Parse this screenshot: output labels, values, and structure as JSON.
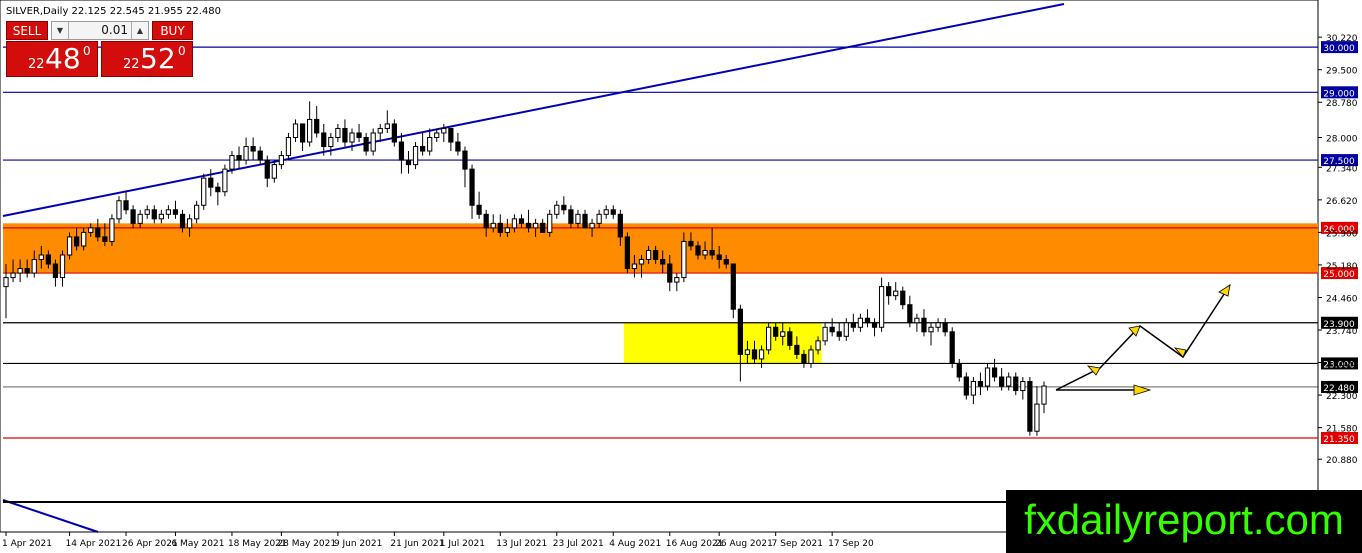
{
  "header": {
    "symbol_line": "SILVER,Daily  22.125 22.545 21.955 22.480"
  },
  "trade_panel": {
    "sell_label": "SELL",
    "buy_label": "BUY",
    "lot": "0.01",
    "sell_big": "22",
    "sell_main": "48",
    "sell_sup": "0",
    "buy_big": "22",
    "buy_main": "52",
    "buy_sup": "0"
  },
  "brand": {
    "text": "fxdailyreport.com",
    "text_color": "#33ff00",
    "bg_color": "#000000"
  },
  "chart_data": {
    "type": "candlestick",
    "symbol": "SILVER",
    "timeframe": "Daily",
    "ylim": [
      20.5,
      30.8
    ],
    "y_ticks": [
      "30.220",
      "29.500",
      "28.780",
      "28.000",
      "27.340",
      "26.620",
      "25.900",
      "25.180",
      "24.460",
      "23.740",
      "23.020",
      "22.300",
      "21.580",
      "20.880"
    ],
    "x_labels": [
      "1 Apr 2021",
      "14 Apr 2021",
      "26 Apr 2021",
      "6 May 2021",
      "18 May 2021",
      "28 May 2021",
      "9 Jun 2021",
      "21 Jun 2021",
      "1 Jul 2021",
      "13 Jul 2021",
      "23 Jul 2021",
      "4 Aug 2021",
      "16 Aug 2021",
      "26 Aug 2021",
      "7 Sep 2021",
      "17 Sep 20"
    ],
    "x_label_index": [
      0,
      9,
      17,
      24,
      32,
      39,
      47,
      55,
      62,
      70,
      78,
      86,
      94,
      101,
      109,
      117
    ],
    "n_bars": 126,
    "candles_ohlc": [
      [
        24.7,
        25.2,
        24.0,
        24.9
      ],
      [
        24.9,
        25.3,
        24.8,
        25.0
      ],
      [
        25.0,
        25.3,
        24.8,
        25.1
      ],
      [
        25.1,
        25.3,
        24.9,
        25.0
      ],
      [
        25.0,
        25.5,
        24.9,
        25.3
      ],
      [
        25.3,
        25.6,
        25.1,
        25.4
      ],
      [
        25.4,
        25.5,
        25.1,
        25.2
      ],
      [
        25.2,
        25.3,
        24.7,
        24.9
      ],
      [
        24.9,
        25.5,
        24.7,
        25.4
      ],
      [
        25.4,
        25.9,
        25.3,
        25.8
      ],
      [
        25.8,
        26.0,
        25.5,
        25.6
      ],
      [
        25.6,
        26.0,
        25.5,
        25.9
      ],
      [
        25.9,
        26.1,
        25.8,
        26.0
      ],
      [
        26.0,
        26.2,
        25.7,
        25.8
      ],
      [
        25.8,
        26.1,
        25.6,
        25.7
      ],
      [
        25.7,
        26.3,
        25.6,
        26.2
      ],
      [
        26.2,
        26.7,
        26.1,
        26.6
      ],
      [
        26.6,
        26.8,
        26.3,
        26.4
      ],
      [
        26.4,
        26.5,
        26.0,
        26.1
      ],
      [
        26.1,
        26.4,
        26.0,
        26.3
      ],
      [
        26.3,
        26.5,
        26.2,
        26.4
      ],
      [
        26.4,
        26.5,
        26.1,
        26.2
      ],
      [
        26.2,
        26.4,
        26.1,
        26.3
      ],
      [
        26.3,
        26.5,
        26.2,
        26.4
      ],
      [
        26.4,
        26.6,
        26.2,
        26.3
      ],
      [
        26.3,
        26.4,
        25.9,
        26.0
      ],
      [
        26.0,
        26.3,
        25.8,
        26.2
      ],
      [
        26.2,
        26.6,
        26.1,
        26.5
      ],
      [
        26.5,
        27.2,
        26.4,
        27.1
      ],
      [
        27.1,
        27.3,
        26.7,
        26.9
      ],
      [
        26.9,
        27.0,
        26.5,
        26.8
      ],
      [
        26.8,
        27.4,
        26.7,
        27.3
      ],
      [
        27.3,
        27.7,
        27.2,
        27.6
      ],
      [
        27.6,
        27.8,
        27.3,
        27.5
      ],
      [
        27.5,
        28.0,
        27.4,
        27.8
      ],
      [
        27.8,
        28.0,
        27.5,
        27.7
      ],
      [
        27.7,
        27.8,
        27.4,
        27.5
      ],
      [
        27.5,
        27.6,
        26.9,
        27.1
      ],
      [
        27.1,
        27.5,
        27.0,
        27.4
      ],
      [
        27.4,
        27.7,
        27.3,
        27.6
      ],
      [
        27.6,
        28.1,
        27.5,
        28.0
      ],
      [
        28.0,
        28.4,
        27.9,
        28.3
      ],
      [
        28.3,
        28.3,
        27.7,
        27.9
      ],
      [
        27.9,
        28.8,
        27.8,
        28.4
      ],
      [
        28.4,
        28.7,
        28.0,
        28.1
      ],
      [
        28.1,
        28.3,
        27.6,
        27.8
      ],
      [
        27.8,
        28.1,
        27.6,
        28.0
      ],
      [
        28.0,
        28.3,
        27.9,
        28.2
      ],
      [
        28.2,
        28.4,
        27.8,
        27.9
      ],
      [
        27.9,
        28.2,
        27.7,
        28.1
      ],
      [
        28.1,
        28.3,
        27.9,
        28.0
      ],
      [
        28.0,
        28.1,
        27.6,
        27.7
      ],
      [
        27.7,
        28.2,
        27.6,
        28.1
      ],
      [
        28.1,
        28.3,
        27.9,
        28.2
      ],
      [
        28.2,
        28.6,
        28.1,
        28.3
      ],
      [
        28.3,
        28.4,
        27.8,
        27.9
      ],
      [
        27.9,
        28.1,
        27.2,
        27.5
      ],
      [
        27.5,
        27.7,
        27.2,
        27.4
      ],
      [
        27.4,
        27.9,
        27.3,
        27.8
      ],
      [
        27.8,
        28.1,
        27.6,
        27.7
      ],
      [
        27.7,
        28.2,
        27.6,
        28.0
      ],
      [
        28.0,
        28.2,
        27.9,
        28.1
      ],
      [
        28.1,
        28.3,
        27.9,
        28.2
      ],
      [
        28.2,
        28.2,
        27.7,
        27.9
      ],
      [
        27.9,
        28.1,
        27.6,
        27.7
      ],
      [
        27.7,
        27.8,
        26.9,
        27.3
      ],
      [
        27.3,
        27.4,
        26.2,
        26.5
      ],
      [
        26.5,
        26.8,
        26.2,
        26.3
      ],
      [
        26.3,
        26.4,
        25.8,
        26.0
      ],
      [
        26.0,
        26.3,
        25.9,
        26.1
      ]
    ],
    "candles_ohlc_2": [
      [
        26.1,
        26.3,
        25.8,
        25.9
      ],
      [
        25.9,
        26.2,
        25.8,
        26.0
      ],
      [
        26.0,
        26.3,
        25.9,
        26.2
      ],
      [
        26.2,
        26.3,
        26.0,
        26.1
      ],
      [
        26.1,
        26.4,
        25.9,
        26.0
      ],
      [
        26.0,
        26.2,
        25.8,
        26.1
      ],
      [
        26.1,
        26.2,
        25.9,
        25.9
      ],
      [
        25.9,
        26.4,
        25.8,
        26.3
      ],
      [
        26.3,
        26.6,
        26.2,
        26.5
      ],
      [
        26.5,
        26.7,
        26.3,
        26.4
      ],
      [
        26.4,
        26.5,
        26.0,
        26.1
      ],
      [
        26.1,
        26.4,
        26.0,
        26.3
      ],
      [
        26.3,
        26.4,
        26.0,
        26.0
      ],
      [
        26.0,
        26.2,
        25.8,
        26.1
      ],
      [
        26.1,
        26.4,
        26.0,
        26.3
      ],
      [
        26.3,
        26.5,
        26.2,
        26.4
      ],
      [
        26.4,
        26.5,
        26.2,
        26.3
      ],
      [
        26.3,
        26.4,
        25.6,
        25.8
      ],
      [
        25.8,
        25.9,
        25.0,
        25.1
      ],
      [
        25.1,
        25.4,
        24.9,
        25.2
      ],
      [
        25.2,
        25.4,
        24.9,
        25.3
      ],
      [
        25.3,
        25.6,
        25.2,
        25.5
      ],
      [
        25.5,
        25.6,
        25.2,
        25.3
      ],
      [
        25.3,
        25.5,
        25.0,
        25.2
      ],
      [
        25.2,
        25.4,
        24.6,
        24.8
      ],
      [
        24.8,
        25.0,
        24.6,
        24.9
      ],
      [
        24.9,
        25.9,
        24.8,
        25.7
      ],
      [
        25.7,
        25.9,
        25.5,
        25.6
      ],
      [
        25.6,
        25.7,
        25.3,
        25.4
      ],
      [
        25.4,
        25.7,
        25.3,
        25.5
      ],
      [
        25.5,
        26.0,
        25.3,
        25.4
      ],
      [
        25.4,
        25.6,
        25.1,
        25.3
      ],
      [
        25.3,
        25.4,
        25.1,
        25.2
      ],
      [
        25.2,
        25.2,
        24.0,
        24.2
      ],
      [
        24.2,
        24.3,
        22.6,
        23.2
      ],
      [
        23.2,
        23.5,
        23.0,
        23.3
      ],
      [
        23.3,
        23.5,
        23.0,
        23.1
      ],
      [
        23.1,
        23.4,
        22.9,
        23.3
      ],
      [
        23.3,
        23.9,
        23.2,
        23.8
      ],
      [
        23.8,
        23.9,
        23.5,
        23.6
      ]
    ],
    "candles_ohlc_3": [
      [
        23.6,
        23.9,
        23.4,
        23.7
      ],
      [
        23.7,
        23.8,
        23.3,
        23.4
      ],
      [
        23.4,
        23.6,
        23.1,
        23.2
      ],
      [
        23.2,
        23.3,
        22.9,
        23.0
      ],
      [
        23.0,
        23.4,
        22.9,
        23.3
      ],
      [
        23.3,
        23.6,
        23.2,
        23.5
      ],
      [
        23.5,
        23.9,
        23.4,
        23.8
      ],
      [
        23.8,
        24.0,
        23.6,
        23.7
      ],
      [
        23.7,
        23.9,
        23.5,
        23.6
      ],
      [
        23.6,
        24.0,
        23.5,
        23.9
      ],
      [
        23.9,
        24.1,
        23.7,
        23.8
      ],
      [
        23.8,
        24.1,
        23.7,
        24.0
      ],
      [
        24.0,
        24.2,
        23.8,
        23.9
      ],
      [
        23.9,
        24.0,
        23.6,
        23.8
      ],
      [
        23.8,
        24.9,
        23.7,
        24.7
      ],
      [
        24.7,
        24.8,
        24.3,
        24.5
      ],
      [
        24.5,
        24.8,
        24.4,
        24.6
      ],
      [
        24.6,
        24.7,
        24.2,
        24.3
      ],
      [
        24.3,
        24.5,
        23.8,
        23.9
      ],
      [
        23.9,
        24.1,
        23.7,
        24.0
      ],
      [
        24.0,
        24.2,
        23.6,
        23.7
      ],
      [
        23.7,
        23.9,
        23.4,
        23.8
      ],
      [
        23.8,
        24.0,
        23.7,
        23.9
      ],
      [
        23.9,
        24.0,
        23.6,
        23.7
      ],
      [
        23.7,
        23.8,
        22.9,
        23.0
      ],
      [
        23.0,
        23.1,
        22.6,
        22.7
      ],
      [
        22.7,
        22.8,
        22.2,
        22.3
      ],
      [
        22.3,
        22.7,
        22.1,
        22.6
      ],
      [
        22.6,
        22.8,
        22.3,
        22.5
      ],
      [
        22.5,
        23.0,
        22.4,
        22.9
      ],
      [
        22.9,
        23.1,
        22.6,
        22.7
      ],
      [
        22.7,
        22.9,
        22.4,
        22.5
      ],
      [
        22.5,
        22.8,
        22.4,
        22.7
      ],
      [
        22.7,
        22.8,
        22.3,
        22.4
      ],
      [
        22.4,
        22.7,
        22.2,
        22.6
      ],
      [
        22.6,
        22.7,
        21.4,
        21.5
      ],
      [
        21.5,
        22.5,
        21.4,
        22.1
      ],
      [
        22.1,
        22.6,
        21.9,
        22.5
      ]
    ],
    "horizontal_levels": [
      {
        "price": 30.0,
        "label": "30.000",
        "color": "#0000a0"
      },
      {
        "price": 29.0,
        "label": "29.000",
        "color": "#0000a0"
      },
      {
        "price": 27.5,
        "label": "27.500",
        "color": "#0000a0"
      },
      {
        "price": 26.0,
        "label": "26.000",
        "color": "#e00000"
      },
      {
        "price": 25.0,
        "label": "25.000",
        "color": "#e00000"
      },
      {
        "price": 23.9,
        "label": "23.900",
        "color": "#000000"
      },
      {
        "price": 23.0,
        "label": "23.000",
        "color": "#000000"
      },
      {
        "price": 22.48,
        "label": "22.480",
        "color": "#000000"
      },
      {
        "price": 21.35,
        "label": "21.350",
        "color": "#e00000"
      }
    ],
    "zones": [
      {
        "price_low": 25.0,
        "price_high": 26.1,
        "color": "#ff8c00"
      },
      {
        "price_low": 23.0,
        "price_high": 23.9,
        "from_bar": 88,
        "to_bar": 115,
        "color": "#ffff00"
      }
    ],
    "colors": {
      "bull": "#ffffff",
      "bear": "#000000",
      "trend": "#0000b0",
      "arrow": "#ffd700",
      "axis_text": "#000000"
    }
  }
}
